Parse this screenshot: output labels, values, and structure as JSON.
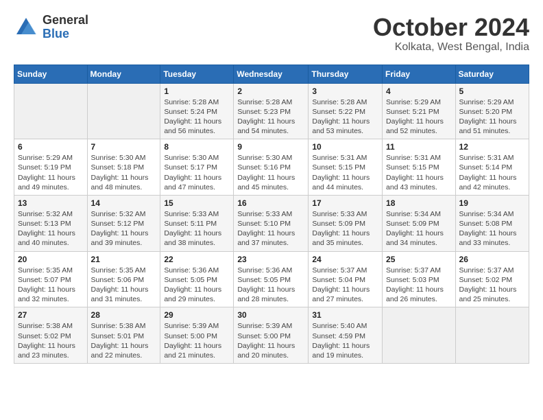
{
  "logo": {
    "general": "General",
    "blue": "Blue"
  },
  "title": "October 2024",
  "location": "Kolkata, West Bengal, India",
  "weekdays": [
    "Sunday",
    "Monday",
    "Tuesday",
    "Wednesday",
    "Thursday",
    "Friday",
    "Saturday"
  ],
  "weeks": [
    [
      {
        "day": "",
        "sunrise": "",
        "sunset": "",
        "daylight": ""
      },
      {
        "day": "",
        "sunrise": "",
        "sunset": "",
        "daylight": ""
      },
      {
        "day": "1",
        "sunrise": "Sunrise: 5:28 AM",
        "sunset": "Sunset: 5:24 PM",
        "daylight": "Daylight: 11 hours and 56 minutes."
      },
      {
        "day": "2",
        "sunrise": "Sunrise: 5:28 AM",
        "sunset": "Sunset: 5:23 PM",
        "daylight": "Daylight: 11 hours and 54 minutes."
      },
      {
        "day": "3",
        "sunrise": "Sunrise: 5:28 AM",
        "sunset": "Sunset: 5:22 PM",
        "daylight": "Daylight: 11 hours and 53 minutes."
      },
      {
        "day": "4",
        "sunrise": "Sunrise: 5:29 AM",
        "sunset": "Sunset: 5:21 PM",
        "daylight": "Daylight: 11 hours and 52 minutes."
      },
      {
        "day": "5",
        "sunrise": "Sunrise: 5:29 AM",
        "sunset": "Sunset: 5:20 PM",
        "daylight": "Daylight: 11 hours and 51 minutes."
      }
    ],
    [
      {
        "day": "6",
        "sunrise": "Sunrise: 5:29 AM",
        "sunset": "Sunset: 5:19 PM",
        "daylight": "Daylight: 11 hours and 49 minutes."
      },
      {
        "day": "7",
        "sunrise": "Sunrise: 5:30 AM",
        "sunset": "Sunset: 5:18 PM",
        "daylight": "Daylight: 11 hours and 48 minutes."
      },
      {
        "day": "8",
        "sunrise": "Sunrise: 5:30 AM",
        "sunset": "Sunset: 5:17 PM",
        "daylight": "Daylight: 11 hours and 47 minutes."
      },
      {
        "day": "9",
        "sunrise": "Sunrise: 5:30 AM",
        "sunset": "Sunset: 5:16 PM",
        "daylight": "Daylight: 11 hours and 45 minutes."
      },
      {
        "day": "10",
        "sunrise": "Sunrise: 5:31 AM",
        "sunset": "Sunset: 5:15 PM",
        "daylight": "Daylight: 11 hours and 44 minutes."
      },
      {
        "day": "11",
        "sunrise": "Sunrise: 5:31 AM",
        "sunset": "Sunset: 5:15 PM",
        "daylight": "Daylight: 11 hours and 43 minutes."
      },
      {
        "day": "12",
        "sunrise": "Sunrise: 5:31 AM",
        "sunset": "Sunset: 5:14 PM",
        "daylight": "Daylight: 11 hours and 42 minutes."
      }
    ],
    [
      {
        "day": "13",
        "sunrise": "Sunrise: 5:32 AM",
        "sunset": "Sunset: 5:13 PM",
        "daylight": "Daylight: 11 hours and 40 minutes."
      },
      {
        "day": "14",
        "sunrise": "Sunrise: 5:32 AM",
        "sunset": "Sunset: 5:12 PM",
        "daylight": "Daylight: 11 hours and 39 minutes."
      },
      {
        "day": "15",
        "sunrise": "Sunrise: 5:33 AM",
        "sunset": "Sunset: 5:11 PM",
        "daylight": "Daylight: 11 hours and 38 minutes."
      },
      {
        "day": "16",
        "sunrise": "Sunrise: 5:33 AM",
        "sunset": "Sunset: 5:10 PM",
        "daylight": "Daylight: 11 hours and 37 minutes."
      },
      {
        "day": "17",
        "sunrise": "Sunrise: 5:33 AM",
        "sunset": "Sunset: 5:09 PM",
        "daylight": "Daylight: 11 hours and 35 minutes."
      },
      {
        "day": "18",
        "sunrise": "Sunrise: 5:34 AM",
        "sunset": "Sunset: 5:09 PM",
        "daylight": "Daylight: 11 hours and 34 minutes."
      },
      {
        "day": "19",
        "sunrise": "Sunrise: 5:34 AM",
        "sunset": "Sunset: 5:08 PM",
        "daylight": "Daylight: 11 hours and 33 minutes."
      }
    ],
    [
      {
        "day": "20",
        "sunrise": "Sunrise: 5:35 AM",
        "sunset": "Sunset: 5:07 PM",
        "daylight": "Daylight: 11 hours and 32 minutes."
      },
      {
        "day": "21",
        "sunrise": "Sunrise: 5:35 AM",
        "sunset": "Sunset: 5:06 PM",
        "daylight": "Daylight: 11 hours and 31 minutes."
      },
      {
        "day": "22",
        "sunrise": "Sunrise: 5:36 AM",
        "sunset": "Sunset: 5:05 PM",
        "daylight": "Daylight: 11 hours and 29 minutes."
      },
      {
        "day": "23",
        "sunrise": "Sunrise: 5:36 AM",
        "sunset": "Sunset: 5:05 PM",
        "daylight": "Daylight: 11 hours and 28 minutes."
      },
      {
        "day": "24",
        "sunrise": "Sunrise: 5:37 AM",
        "sunset": "Sunset: 5:04 PM",
        "daylight": "Daylight: 11 hours and 27 minutes."
      },
      {
        "day": "25",
        "sunrise": "Sunrise: 5:37 AM",
        "sunset": "Sunset: 5:03 PM",
        "daylight": "Daylight: 11 hours and 26 minutes."
      },
      {
        "day": "26",
        "sunrise": "Sunrise: 5:37 AM",
        "sunset": "Sunset: 5:02 PM",
        "daylight": "Daylight: 11 hours and 25 minutes."
      }
    ],
    [
      {
        "day": "27",
        "sunrise": "Sunrise: 5:38 AM",
        "sunset": "Sunset: 5:02 PM",
        "daylight": "Daylight: 11 hours and 23 minutes."
      },
      {
        "day": "28",
        "sunrise": "Sunrise: 5:38 AM",
        "sunset": "Sunset: 5:01 PM",
        "daylight": "Daylight: 11 hours and 22 minutes."
      },
      {
        "day": "29",
        "sunrise": "Sunrise: 5:39 AM",
        "sunset": "Sunset: 5:00 PM",
        "daylight": "Daylight: 11 hours and 21 minutes."
      },
      {
        "day": "30",
        "sunrise": "Sunrise: 5:39 AM",
        "sunset": "Sunset: 5:00 PM",
        "daylight": "Daylight: 11 hours and 20 minutes."
      },
      {
        "day": "31",
        "sunrise": "Sunrise: 5:40 AM",
        "sunset": "Sunset: 4:59 PM",
        "daylight": "Daylight: 11 hours and 19 minutes."
      },
      {
        "day": "",
        "sunrise": "",
        "sunset": "",
        "daylight": ""
      },
      {
        "day": "",
        "sunrise": "",
        "sunset": "",
        "daylight": ""
      }
    ]
  ]
}
